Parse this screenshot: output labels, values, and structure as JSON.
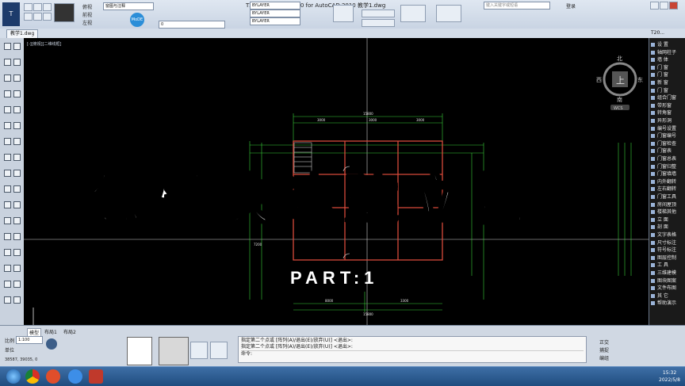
{
  "window": {
    "title": "T20天正建筑软件 V1.0 for AutoCAD 2010   教学1.dwg",
    "search_placeholder": "键入关键字或短语",
    "login_label": "登录"
  },
  "toolbar": {
    "layer_value": "0",
    "linetype_1": "BYLAYER",
    "linetype_2": "BYLAYER",
    "linetype_3": "BYLAYER",
    "view_labels": [
      "俯视",
      "前视",
      "左视"
    ],
    "style_combo": "窗图与注释",
    "badge": "MoDE"
  },
  "document_tab": "教学1.dwg",
  "viewport_label": "[-][俯视][二维线框]",
  "right_panel": {
    "header": "T20...",
    "items": [
      "设 置",
      "轴网柱子",
      "墙 体",
      "门 窗",
      "门 窗",
      "新 窗",
      "门 窗",
      "组合门窗",
      "带形窗",
      "转角窗",
      "异形洞",
      "编号设置",
      "门窗编号",
      "门窗检查",
      "门窗表",
      "门窗总表",
      "门窗归整",
      "门窗填墙",
      "内外翻转",
      "左右翻转",
      "门窗工具",
      "房间屋顶",
      "楼梯其他",
      "立 面",
      "剖 面",
      "文字表格",
      "尺寸标注",
      "符号标注",
      "图层控制",
      "工 具",
      "三维建模",
      "图块图案",
      "文件布图",
      "其 它",
      "帮助演示"
    ]
  },
  "compass": {
    "north": "北",
    "south": "南",
    "east": "东",
    "west": "西",
    "top": "上",
    "ucs": "WCS"
  },
  "overlay": {
    "headline": "怎样快速建立门",
    "subtitle": "PART:1"
  },
  "drawing": {
    "dims_top": [
      "3000",
      "3000",
      "3000"
    ],
    "dim_total_top": "15800",
    "dims_bottom": [
      "8000",
      "3300"
    ],
    "dim_total_bottom": "15800",
    "dim_side_right": "9000",
    "dim_side_left": "7200"
  },
  "status": {
    "layout_tabs": [
      "模型",
      "布局1",
      "布局2"
    ],
    "scale_label": "比例",
    "scale_value": "1:100",
    "unit_label": "单位",
    "coords": "38587, 39035, 0",
    "cmd_lines": [
      "指定第二个点或 [阵列(A)/退出(E)/放弃(U)] <退出>:",
      "指定第二个点或 [阵列(A)/退出(E)/放弃(U)] <退出>:"
    ],
    "cmd_prompt": "命令:",
    "right_labels": [
      "正交",
      "捕捉",
      "编组"
    ]
  },
  "taskbar": {
    "time": "15:32",
    "date": "2022/5/8"
  },
  "colors": {
    "drawing_green": "#3ad13a",
    "drawing_red": "#d84a3a",
    "drawing_white": "#e6e6e6"
  }
}
